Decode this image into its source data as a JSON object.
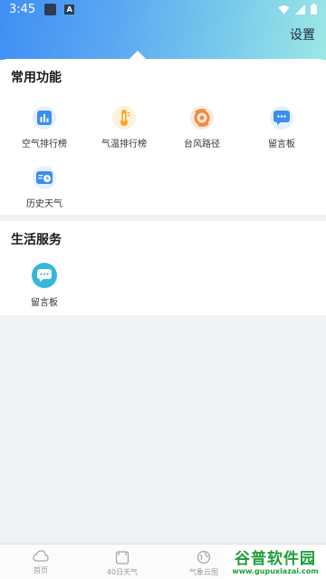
{
  "status_bar": {
    "time": "3:45",
    "a_badge": "A"
  },
  "header": {
    "settings_label": "设置"
  },
  "common_section": {
    "title": "常用功能",
    "items": [
      {
        "label": "空气排行榜",
        "icon": "air-ranking-icon",
        "color": "#3a8ef2"
      },
      {
        "label": "气温排行榜",
        "icon": "thermometer-icon",
        "color": "#f5a623"
      },
      {
        "label": "台风路径",
        "icon": "typhoon-icon",
        "color": "#f08a3a"
      },
      {
        "label": "留言板",
        "icon": "message-board-icon",
        "color": "#3a8ef2"
      },
      {
        "label": "历史天气",
        "icon": "history-weather-icon",
        "color": "#3a8ef2"
      }
    ]
  },
  "life_section": {
    "title": "生活服务",
    "items": [
      {
        "label": "留言板",
        "icon": "chat-bubble-icon",
        "color": "#36b7d9"
      }
    ]
  },
  "bottom_nav": {
    "items": [
      {
        "label": "首页",
        "icon": "cloud-icon"
      },
      {
        "label": "40日天气",
        "icon": "calendar-icon"
      },
      {
        "label": "气象云图",
        "icon": "globe-icon"
      }
    ]
  },
  "watermark": {
    "main": "谷普软件园",
    "url": "www.gupuxiazai.com"
  }
}
